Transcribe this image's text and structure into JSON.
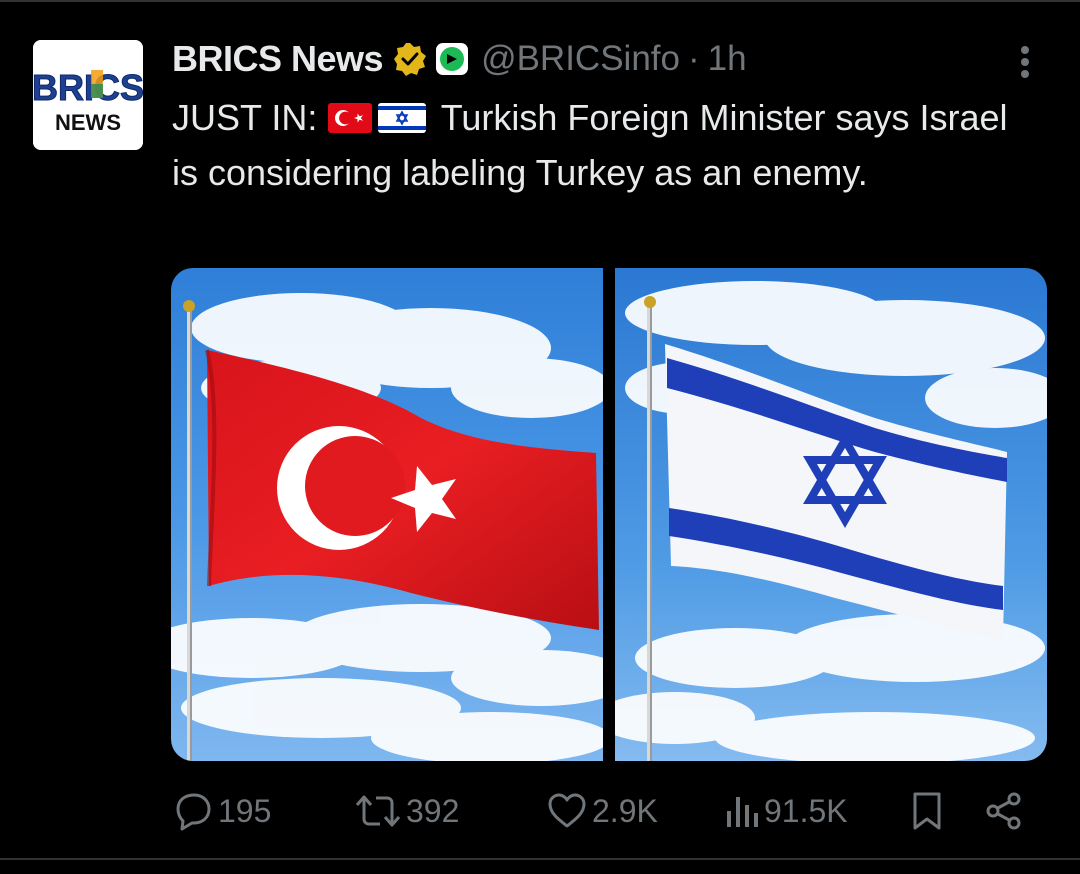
{
  "tweet": {
    "author_name": "BRICS News",
    "handle": "@BRICSinfo",
    "separator": "·",
    "time": "1h",
    "avatar_text_top": "BRICS",
    "avatar_text_bottom": "NEWS",
    "text_lead": "JUST IN:",
    "text_body": "Turkish Foreign Minister says Israel is considering labeling Turkey as an enemy.",
    "text_icons": [
      "turkey-flag-emoji",
      "israel-flag-emoji"
    ]
  },
  "media": {
    "images": [
      {
        "name": "turkish-flag-photo",
        "icon": "turkey-flag"
      },
      {
        "name": "israeli-flag-photo",
        "icon": "israel-flag"
      }
    ]
  },
  "actions": {
    "replies": "195",
    "reposts": "392",
    "likes": "2.9K",
    "views": "91.5K"
  },
  "colors": {
    "background": "#000000",
    "text": "#e7e9ea",
    "secondary": "#71767b",
    "verified_gold": "#e2b719"
  }
}
